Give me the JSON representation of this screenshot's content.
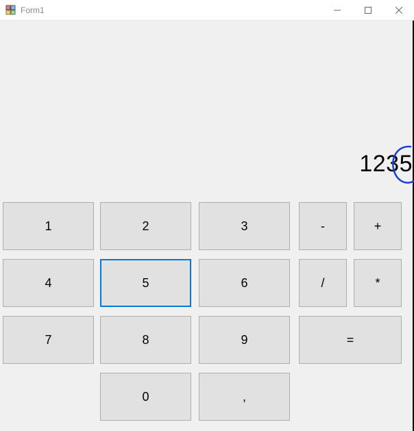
{
  "window": {
    "title": "Form1"
  },
  "display": {
    "value": "1235"
  },
  "buttons": {
    "n1": "1",
    "n2": "2",
    "n3": "3",
    "minus": "-",
    "plus": "+",
    "n4": "4",
    "n5": "5",
    "n6": "6",
    "divide": "/",
    "multiply": "*",
    "n7": "7",
    "n8": "8",
    "n9": "9",
    "equals": "=",
    "n0": "0",
    "comma": ","
  }
}
